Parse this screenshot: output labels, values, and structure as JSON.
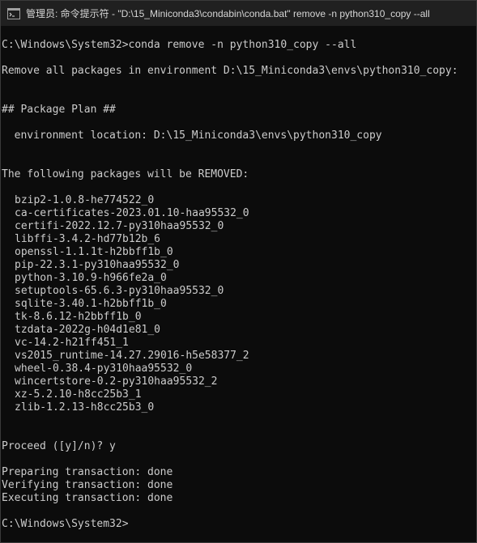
{
  "window": {
    "title": "管理员: 命令提示符 - \"D:\\15_Miniconda3\\condabin\\conda.bat\"  remove -n python310_copy --all",
    "icon": "cmd-icon"
  },
  "terminal": {
    "command_line": "C:\\Windows\\System32>conda remove -n python310_copy --all",
    "remove_all_msg": "Remove all packages in environment D:\\15_Miniconda3\\envs\\python310_copy:",
    "package_plan_header": "## Package Plan ##",
    "environment_location": "  environment location: D:\\15_Miniconda3\\envs\\python310_copy",
    "removed_header": "The following packages will be REMOVED:",
    "packages": [
      "bzip2-1.0.8-he774522_0",
      "ca-certificates-2023.01.10-haa95532_0",
      "certifi-2022.12.7-py310haa95532_0",
      "libffi-3.4.2-hd77b12b_6",
      "openssl-1.1.1t-h2bbff1b_0",
      "pip-22.3.1-py310haa95532_0",
      "python-3.10.9-h966fe2a_0",
      "setuptools-65.6.3-py310haa95532_0",
      "sqlite-3.40.1-h2bbff1b_0",
      "tk-8.6.12-h2bbff1b_0",
      "tzdata-2022g-h04d1e81_0",
      "vc-14.2-h21ff451_1",
      "vs2015_runtime-14.27.29016-h5e58377_2",
      "wheel-0.38.4-py310haa95532_0",
      "wincertstore-0.2-py310haa95532_2",
      "xz-5.2.10-h8cc25b3_1",
      "zlib-1.2.13-h8cc25b3_0"
    ],
    "proceed_prompt": "Proceed ([y]/n)? y",
    "preparing": "Preparing transaction: done",
    "verifying": "Verifying transaction: done",
    "executing": "Executing transaction: done",
    "final_prompt": "C:\\Windows\\System32>"
  },
  "colors": {
    "background": "#0c0c0c",
    "foreground": "#cccccc",
    "titlebar": "#202020"
  }
}
